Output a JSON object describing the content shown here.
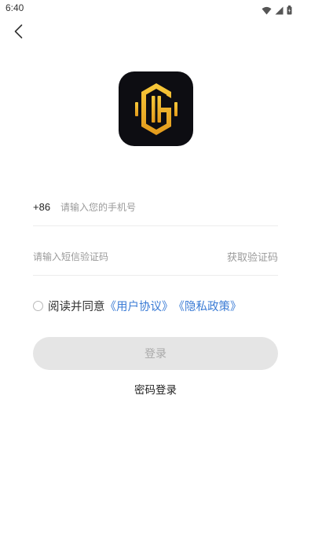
{
  "status_bar": {
    "time": "6:40",
    "icons": [
      "wifi-icon",
      "signal-icon",
      "battery-icon"
    ]
  },
  "nav": {
    "back_icon": "chevron-left-icon"
  },
  "logo": {
    "icon": "app-logo",
    "colors": {
      "background": "#0d0d12",
      "gold": "#f2b72a"
    }
  },
  "phone": {
    "country_code": "+86",
    "placeholder": "请输入您的手机号",
    "value": ""
  },
  "verification": {
    "placeholder": "请输入短信验证码",
    "value": "",
    "get_code_label": "获取验证码"
  },
  "agreement": {
    "checked": false,
    "prefix": "阅读并同意",
    "user_agreement": "《用户协议》",
    "privacy_policy": "《隐私政策》"
  },
  "login_button": {
    "label": "登录",
    "enabled": false
  },
  "password_login_label": "密码登录",
  "colors": {
    "link": "#3a7bd5",
    "button_disabled_bg": "#e5e5e5",
    "button_disabled_text": "#a9a9a9"
  }
}
